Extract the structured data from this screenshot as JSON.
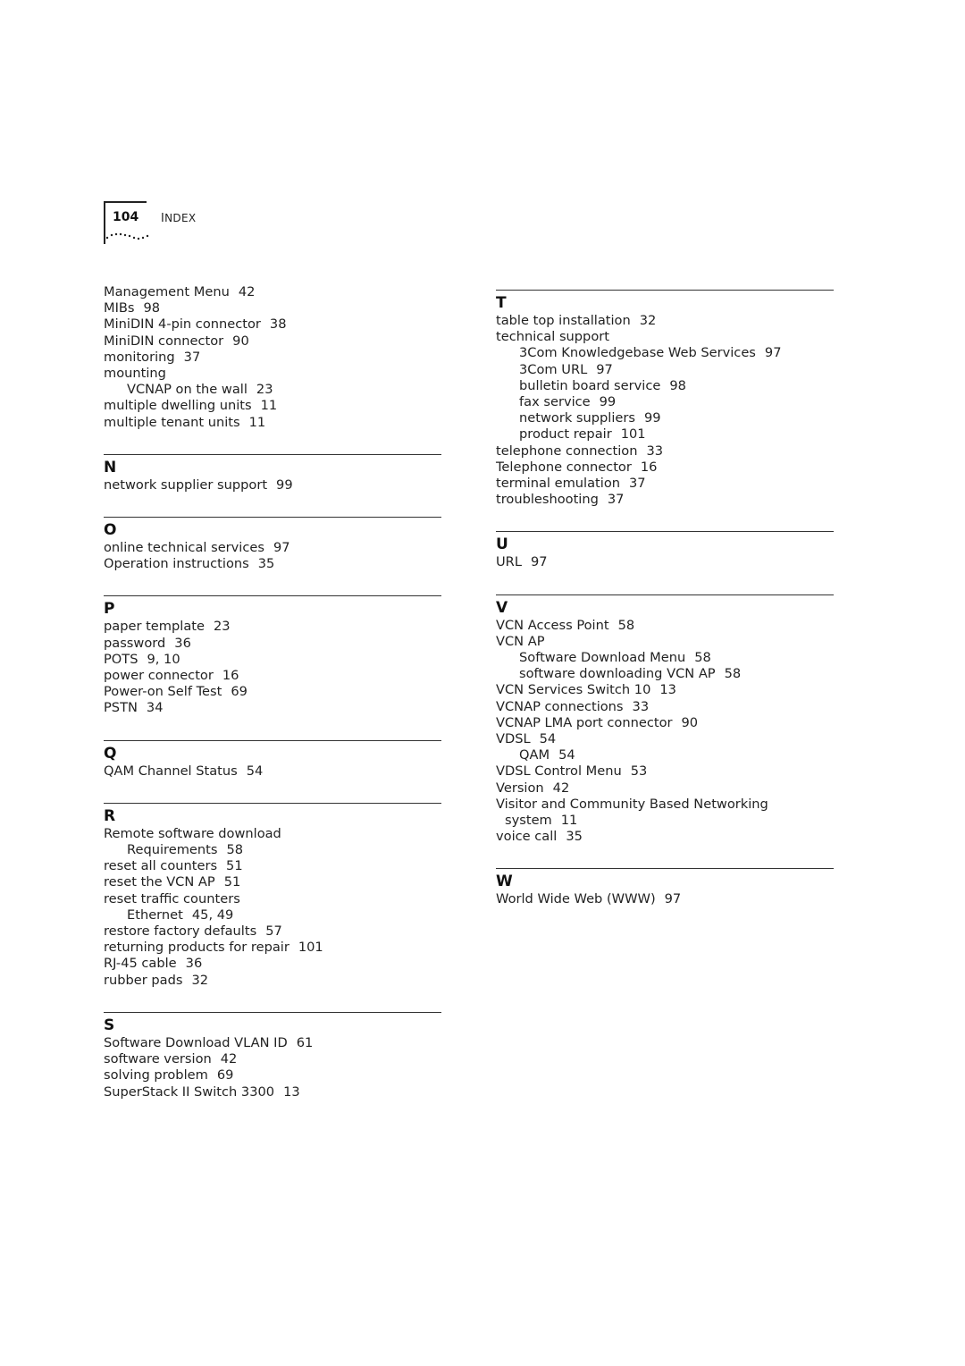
{
  "header": {
    "page_number": "104",
    "running_title": "INDEX"
  },
  "columns": [
    {
      "sections": [
        {
          "letter": "",
          "entries": [
            {
              "text": "Management Menu",
              "pages": "42",
              "level": 0
            },
            {
              "text": "MIBs",
              "pages": "98",
              "level": 0
            },
            {
              "text": "MiniDIN 4-pin connector",
              "pages": "38",
              "level": 0
            },
            {
              "text": "MiniDIN connector",
              "pages": "90",
              "level": 0
            },
            {
              "text": "monitoring",
              "pages": "37",
              "level": 0
            },
            {
              "text": "mounting",
              "pages": "",
              "level": 0
            },
            {
              "text": "VCNAP on the wall",
              "pages": "23",
              "level": 1
            },
            {
              "text": "multiple dwelling units",
              "pages": "11",
              "level": 0
            },
            {
              "text": "multiple tenant units",
              "pages": "11",
              "level": 0
            }
          ]
        },
        {
          "letter": "N",
          "entries": [
            {
              "text": "network supplier support",
              "pages": "99",
              "level": 0
            }
          ]
        },
        {
          "letter": "O",
          "entries": [
            {
              "text": "online technical services",
              "pages": "97",
              "level": 0
            },
            {
              "text": "Operation instructions",
              "pages": "35",
              "level": 0
            }
          ]
        },
        {
          "letter": "P",
          "entries": [
            {
              "text": "paper template",
              "pages": "23",
              "level": 0
            },
            {
              "text": "password",
              "pages": "36",
              "level": 0
            },
            {
              "text": "POTS",
              "pages": "9, 10",
              "level": 0
            },
            {
              "text": "power connector",
              "pages": "16",
              "level": 0
            },
            {
              "text": "Power-on Self Test",
              "pages": "69",
              "level": 0
            },
            {
              "text": "PSTN",
              "pages": "34",
              "level": 0
            }
          ]
        },
        {
          "letter": "Q",
          "entries": [
            {
              "text": "QAM Channel Status",
              "pages": "54",
              "level": 0
            }
          ]
        },
        {
          "letter": "R",
          "entries": [
            {
              "text": "Remote software download",
              "pages": "",
              "level": 0
            },
            {
              "text": "Requirements",
              "pages": "58",
              "level": 1
            },
            {
              "text": "reset all counters",
              "pages": "51",
              "level": 0
            },
            {
              "text": "reset the VCN AP",
              "pages": "51",
              "level": 0
            },
            {
              "text": "reset traffic counters",
              "pages": "",
              "level": 0
            },
            {
              "text": "Ethernet",
              "pages": "45, 49",
              "level": 1
            },
            {
              "text": "restore factory defaults",
              "pages": "57",
              "level": 0
            },
            {
              "text": "returning products for repair",
              "pages": "101",
              "level": 0
            },
            {
              "text": "RJ-45 cable",
              "pages": "36",
              "level": 0
            },
            {
              "text": "rubber pads",
              "pages": "32",
              "level": 0
            }
          ]
        },
        {
          "letter": "S",
          "entries": [
            {
              "text": "Software Download VLAN ID",
              "pages": "61",
              "level": 0
            },
            {
              "text": "software version",
              "pages": "42",
              "level": 0
            },
            {
              "text": "solving problem",
              "pages": "69",
              "level": 0
            },
            {
              "text": "SuperStack II Switch 3300",
              "pages": "13",
              "level": 0
            }
          ]
        }
      ]
    },
    {
      "sections": [
        {
          "letter": "T",
          "entries": [
            {
              "text": "table top installation",
              "pages": "32",
              "level": 0
            },
            {
              "text": "technical support",
              "pages": "",
              "level": 0
            },
            {
              "text": "3Com Knowledgebase Web Services",
              "pages": "97",
              "level": 1
            },
            {
              "text": "3Com URL",
              "pages": "97",
              "level": 1
            },
            {
              "text": "bulletin board service",
              "pages": "98",
              "level": 1
            },
            {
              "text": "fax service",
              "pages": "99",
              "level": 1
            },
            {
              "text": "network suppliers",
              "pages": "99",
              "level": 1
            },
            {
              "text": "product repair",
              "pages": "101",
              "level": 1
            },
            {
              "text": "telephone connection",
              "pages": "33",
              "level": 0
            },
            {
              "text": "Telephone connector",
              "pages": "16",
              "level": 0
            },
            {
              "text": "terminal emulation",
              "pages": "37",
              "level": 0
            },
            {
              "text": "troubleshooting",
              "pages": "37",
              "level": 0
            }
          ]
        },
        {
          "letter": "U",
          "entries": [
            {
              "text": "URL",
              "pages": "97",
              "level": 0
            }
          ]
        },
        {
          "letter": "V",
          "entries": [
            {
              "text": "VCN Access Point",
              "pages": "58",
              "level": 0
            },
            {
              "text": "VCN AP",
              "pages": "",
              "level": 0
            },
            {
              "text": "Software Download Menu",
              "pages": "58",
              "level": 1
            },
            {
              "text": "software downloading VCN AP",
              "pages": "58",
              "level": 1
            },
            {
              "text": "VCN Services Switch 10",
              "pages": "13",
              "level": 0
            },
            {
              "text": "VCNAP connections",
              "pages": "33",
              "level": 0
            },
            {
              "text": "VCNAP LMA port connector",
              "pages": "90",
              "level": 0
            },
            {
              "text": "VDSL",
              "pages": "54",
              "level": 0
            },
            {
              "text": "QAM",
              "pages": "54",
              "level": 1
            },
            {
              "text": "VDSL Control Menu",
              "pages": "53",
              "level": 0
            },
            {
              "text": "Version",
              "pages": "42",
              "level": 0
            },
            {
              "text": "Visitor and Community Based Networking",
              "pages": "",
              "level": 0
            },
            {
              "text": "system",
              "pages": "11",
              "level": 2
            },
            {
              "text": "voice call",
              "pages": "35",
              "level": 0
            }
          ]
        },
        {
          "letter": "W",
          "entries": [
            {
              "text": "World Wide Web (WWW)",
              "pages": "97",
              "level": 0
            }
          ]
        }
      ]
    }
  ]
}
